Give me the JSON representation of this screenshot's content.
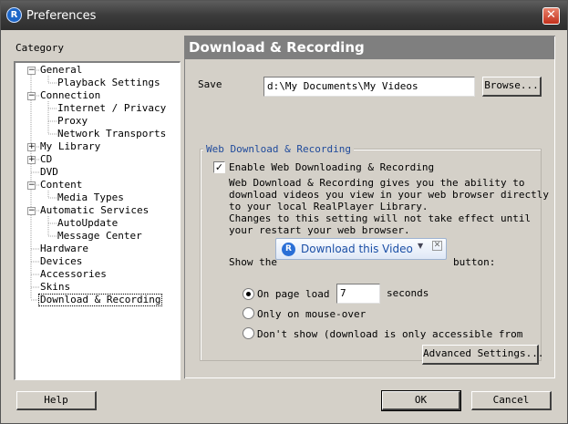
{
  "window": {
    "title": "Preferences",
    "close_glyph": "✕"
  },
  "sidebar": {
    "category_label": "Category",
    "items": [
      {
        "label": "General",
        "expander": "−"
      },
      {
        "label": "Playback Settings"
      },
      {
        "label": "Connection",
        "expander": "−"
      },
      {
        "label": "Internet / Privacy"
      },
      {
        "label": "Proxy"
      },
      {
        "label": "Network Transports"
      },
      {
        "label": "My Library",
        "expander": "+"
      },
      {
        "label": "CD",
        "expander": "+"
      },
      {
        "label": "DVD"
      },
      {
        "label": "Content",
        "expander": "−"
      },
      {
        "label": "Media Types"
      },
      {
        "label": "Automatic Services",
        "expander": "−"
      },
      {
        "label": "AutoUpdate"
      },
      {
        "label": "Message Center"
      },
      {
        "label": "Hardware"
      },
      {
        "label": "Devices"
      },
      {
        "label": "Accessories"
      },
      {
        "label": "Skins"
      },
      {
        "label": "Download & Recording",
        "selected": true
      }
    ]
  },
  "main": {
    "header": "Download & Recording",
    "save_files_label": "Save Files to:",
    "save_files_value": "d:\\My Documents\\My Videos",
    "browse_button": "Browse...",
    "group_title": "Web Download & Recording",
    "enable_checkbox_label": "Enable Web Downloading & Recording",
    "enable_checked": true,
    "description_lines": [
      "Web Download & Recording gives you the ability to",
      "download videos you view in your web browser directly",
      "to your local RealPlayer Library.",
      "Changes to this setting will not take effect until",
      "your restart your web browser."
    ],
    "show_the_label": "Show the",
    "download_widget_label": "Download this Video",
    "button_suffix_label": "button:",
    "radio_options": [
      {
        "label": "On page load f",
        "checked": true
      },
      {
        "label": "Only on mouse-over",
        "checked": false
      },
      {
        "label": "Don't show (download is only accessible from righ",
        "checked": false
      }
    ],
    "seconds_value": "7",
    "seconds_label": "seconds",
    "advanced_button": "Advanced Settings..."
  },
  "footer": {
    "help_button": "Help",
    "ok_button": "OK",
    "cancel_button": "Cancel"
  },
  "colors": {
    "titlebar": "#3b3b3b",
    "panel_header": "#7f7f7f",
    "group_title": "#1f4a9b",
    "close": "#c3301b"
  }
}
